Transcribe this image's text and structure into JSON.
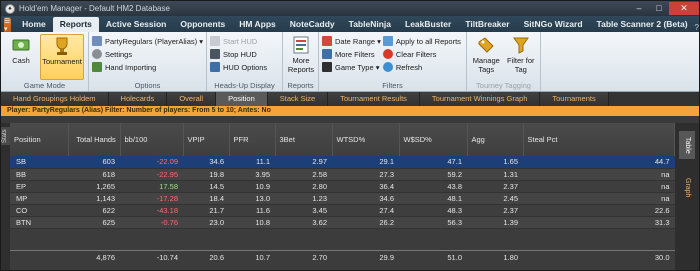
{
  "window": {
    "title": "Hold'em Manager - Default HM2 Database"
  },
  "ribbon_tabs": [
    "Home",
    "Reports",
    "Active Session",
    "Opponents",
    "HM Apps",
    "NoteCaddy",
    "TableNinja",
    "LeakBuster",
    "TiltBreaker",
    "SitNGo Wizard",
    "Table Scanner 2 (Beta)"
  ],
  "ribbon": {
    "game_mode": {
      "cash": "Cash",
      "tournament": "Tournament",
      "label": "Game Mode"
    },
    "options": {
      "player": "PartyRegulars (PlayerAlias)",
      "settings": "Settings",
      "hand_importing": "Hand Importing",
      "label": "Options"
    },
    "hud": {
      "start": "Start HUD",
      "stop": "Stop HUD",
      "options": "HUD Options",
      "label": "Heads-Up Display"
    },
    "reports": {
      "more": "More Reports",
      "label": "Reports"
    },
    "filters": {
      "date_range": "Date Range",
      "more_filters": "More Filters",
      "game_type": "Game Type",
      "apply_all": "Apply to all Reports",
      "clear": "Clear Filters",
      "refresh": "Refresh",
      "label": "Filters"
    },
    "tagging": {
      "manage": "Manage Tags",
      "filter_for_tag": "Filter for Tag",
      "label": "Tourney Tagging"
    }
  },
  "view_tabs": [
    "Hand Groupings Holdem",
    "Holecards",
    "Overall",
    "Position",
    "Stack Size",
    "Tournament Results",
    "Tournament Winnings Graph",
    "Tournaments"
  ],
  "filter_bar": "Player: PartyRegulars (Alias)   Filter: Number of players: From 5 to 10; Antes: No",
  "side_tabs": {
    "left": "Stats",
    "table": "Table",
    "graph": "Graph"
  },
  "table": {
    "columns": [
      "Position",
      "Total Hands",
      "bb/100",
      "VPIP",
      "PFR",
      "3Bet",
      "WTSD%",
      "W$SD%",
      "Agg",
      "Steal Pct"
    ],
    "rows": [
      [
        "SB",
        "603",
        "-22.09",
        "34.6",
        "11.1",
        "2.97",
        "29.1",
        "47.1",
        "1.65",
        "44.7"
      ],
      [
        "BB",
        "618",
        "-22.95",
        "19.8",
        "3.95",
        "2.58",
        "27.3",
        "59.2",
        "1.31",
        "na"
      ],
      [
        "EP",
        "1,265",
        "17.58",
        "14.5",
        "10.9",
        "2.80",
        "36.4",
        "43.8",
        "2.37",
        "na"
      ],
      [
        "MP",
        "1,143",
        "-17.28",
        "18.4",
        "13.0",
        "1.23",
        "34.6",
        "48.1",
        "2.45",
        "na"
      ],
      [
        "CO",
        "622",
        "-43.18",
        "21.7",
        "11.6",
        "3.45",
        "27.4",
        "48.3",
        "2.37",
        "22.6"
      ],
      [
        "BTN",
        "625",
        "-0.76",
        "23.0",
        "10.8",
        "3.62",
        "26.2",
        "56.3",
        "1.39",
        "31.3"
      ]
    ],
    "totals": [
      "",
      "4,876",
      "-10.74",
      "20.6",
      "10.7",
      "2.70",
      "29.9",
      "51.0",
      "1.80",
      "30.0"
    ]
  },
  "colors": {
    "accent": "#f2a33a",
    "selected_row": "#1d3f78",
    "negative": "#ff6b6b",
    "positive": "#9be08a"
  }
}
